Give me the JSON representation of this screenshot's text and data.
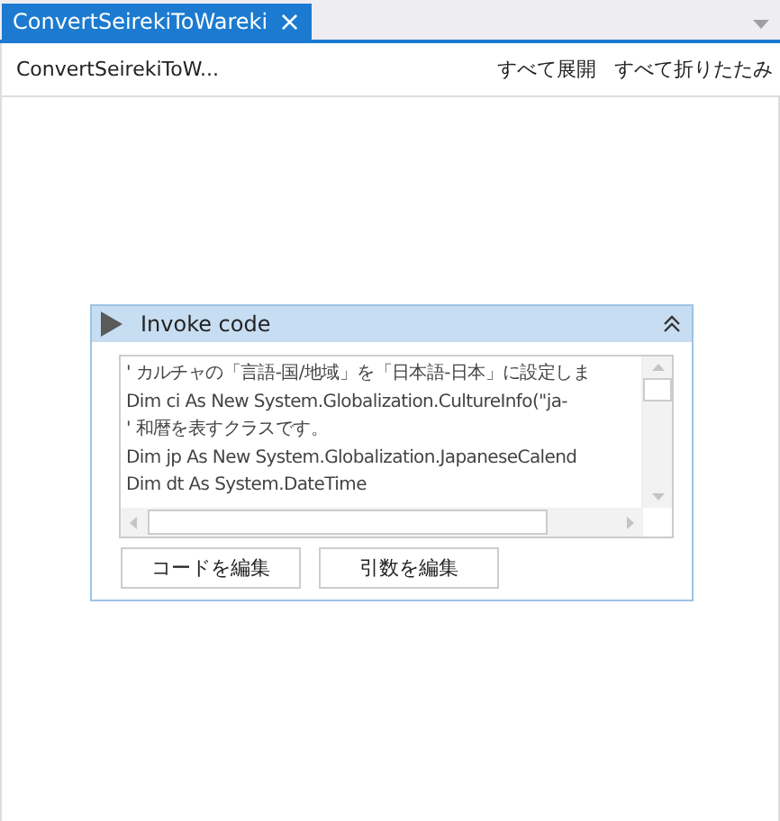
{
  "tabs": [
    {
      "label": "ConvertSeirekiToWareki",
      "close": "×",
      "selected": true
    }
  ],
  "header": {
    "breadcrumb": "ConvertSeirekiToW...",
    "actions": [
      "すべて展開",
      "すべて折りたたみ"
    ]
  },
  "activity": {
    "title": "Invoke code",
    "expanded": true,
    "code_lines": [
      "' カルチャの「言語-国/地域」を「日本語-日本」に設定しま",
      "Dim ci As New System.Globalization.CultureInfo(\"ja-",
      "' 和暦を表すクラスです。",
      "Dim jp As New System.Globalization.JapaneseCalend",
      "Dim dt As System.DateTime"
    ],
    "buttons": [
      "コードを編集",
      "引数を編集"
    ]
  }
}
